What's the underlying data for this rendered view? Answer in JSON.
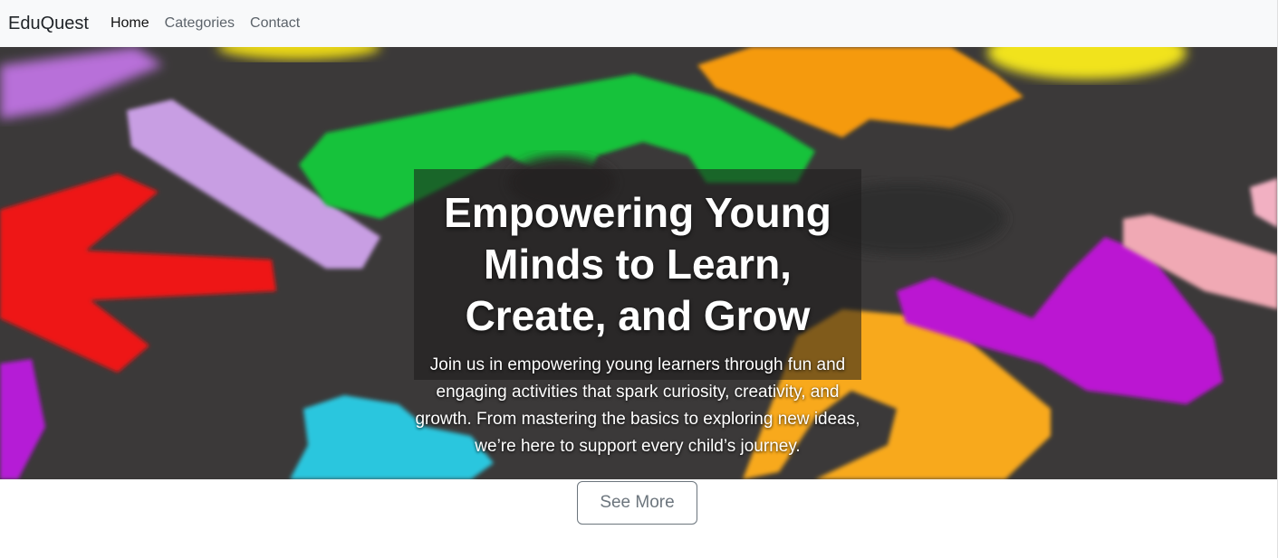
{
  "navbar": {
    "brand": "EduQuest",
    "links": [
      {
        "label": "Home",
        "active": true
      },
      {
        "label": "Categories",
        "active": false
      },
      {
        "label": "Contact",
        "active": false
      }
    ]
  },
  "hero": {
    "image_icon": "felt-letters-background",
    "title": "Empowering Young Minds to Learn, Create, and Grow",
    "description": "Join us in empowering young learners through fun and engaging activities that spark curiosity, creativity, and growth. From mastering the basics to exploring new ideas, we’re here to support every child’s journey."
  },
  "cta": {
    "label": "See More"
  },
  "colors": {
    "navbar_bg": "#f8f9fa",
    "button_border": "#6c757d",
    "hero_bg": "#3a3838"
  }
}
